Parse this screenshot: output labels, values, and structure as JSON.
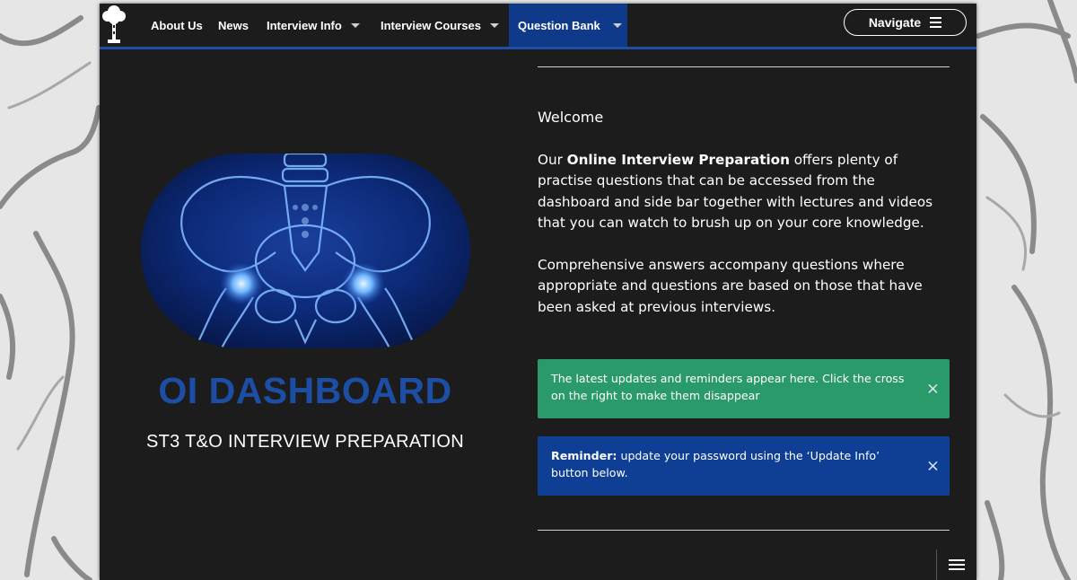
{
  "nav": {
    "items": [
      {
        "label": "About Us",
        "has_dropdown": false
      },
      {
        "label": "News",
        "has_dropdown": false
      },
      {
        "label": "Interview Info",
        "has_dropdown": true
      },
      {
        "label": "Interview Courses",
        "has_dropdown": true
      },
      {
        "label": "Question Bank",
        "has_dropdown": true,
        "active": true
      }
    ],
    "navigate_label": "Navigate",
    "logo_icon": "tree-logo-icon"
  },
  "hero": {
    "image_icon": "pelvis-xray-image",
    "title": "OI DASHBOARD",
    "subtitle": "ST3 T&O INTERVIEW PREPARATION"
  },
  "intro": {
    "welcome": "Welcome",
    "para1_prefix": "Our ",
    "para1_bold": "Online Interview Preparation",
    "para1_rest": " offers plenty of practise questions that can be accessed from the dashboard and side bar together with lectures and videos that you can watch to brush up on your core knowledge.",
    "para2": "Comprehensive answers accompany questions where appropriate and questions are based on those that have been asked at previous interviews."
  },
  "alerts": [
    {
      "bold": "",
      "text": "The latest updates and reminders appear here. Click the cross on the right to make them disappear",
      "close": "×"
    },
    {
      "bold": "Reminder:",
      "text": " update your password using the ‘Update Info’ button below.",
      "close": "×"
    }
  ],
  "colors": {
    "page_bg": "#1c1c1c",
    "accent_blue": "#1d4ea6",
    "active_nav": "#0f3a8a",
    "alert_green": "#2b9a6a",
    "alert_blue": "#0f3f95"
  }
}
